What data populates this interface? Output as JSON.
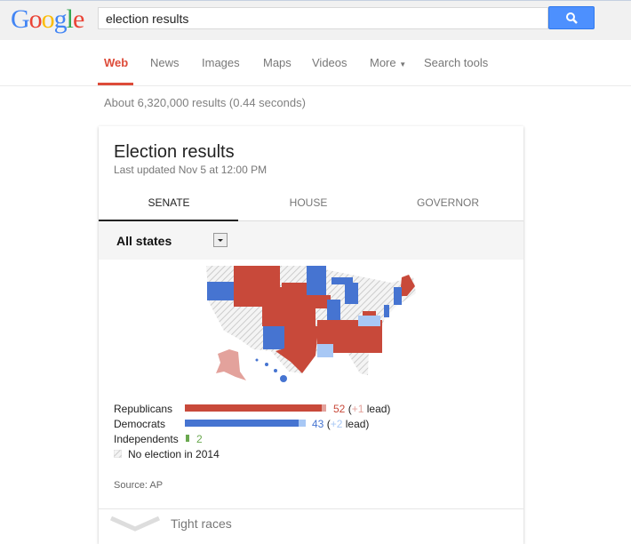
{
  "header": {
    "logo": "Google",
    "search_value": "election results",
    "search_icon": "magnifier-icon"
  },
  "nav": {
    "tabs": [
      "Web",
      "News",
      "Images",
      "Maps",
      "Videos",
      "More",
      "Search tools"
    ],
    "active": "Web"
  },
  "stats": "About 6,320,000 results (0.44 seconds)",
  "card": {
    "title": "Election results",
    "updated": "Last updated Nov 5 at 12:00 PM",
    "tabs": [
      "SENATE",
      "HOUSE",
      "GOVERNOR"
    ],
    "active_tab": "SENATE",
    "filter": "All states",
    "legend": {
      "rep": {
        "label": "Republicans",
        "seats": "52",
        "lead": "+1",
        "lead_word": "lead)",
        "open": "("
      },
      "dem": {
        "label": "Democrats",
        "seats": "43",
        "lead": "+2",
        "lead_word": "lead)",
        "open": "("
      },
      "ind": {
        "label": "Independents",
        "seats": "2"
      },
      "none": {
        "label": "No election in 2014"
      }
    },
    "source": "Source: AP",
    "tight": "Tight races"
  },
  "colors": {
    "rep": "#c8493a",
    "rep_lead": "#e3a29c",
    "dem": "#4674d1",
    "dem_lead": "#a8c8f5",
    "ind": "#6aa84f",
    "accent": "#dd4b39",
    "search_button": "#4d90fe"
  }
}
